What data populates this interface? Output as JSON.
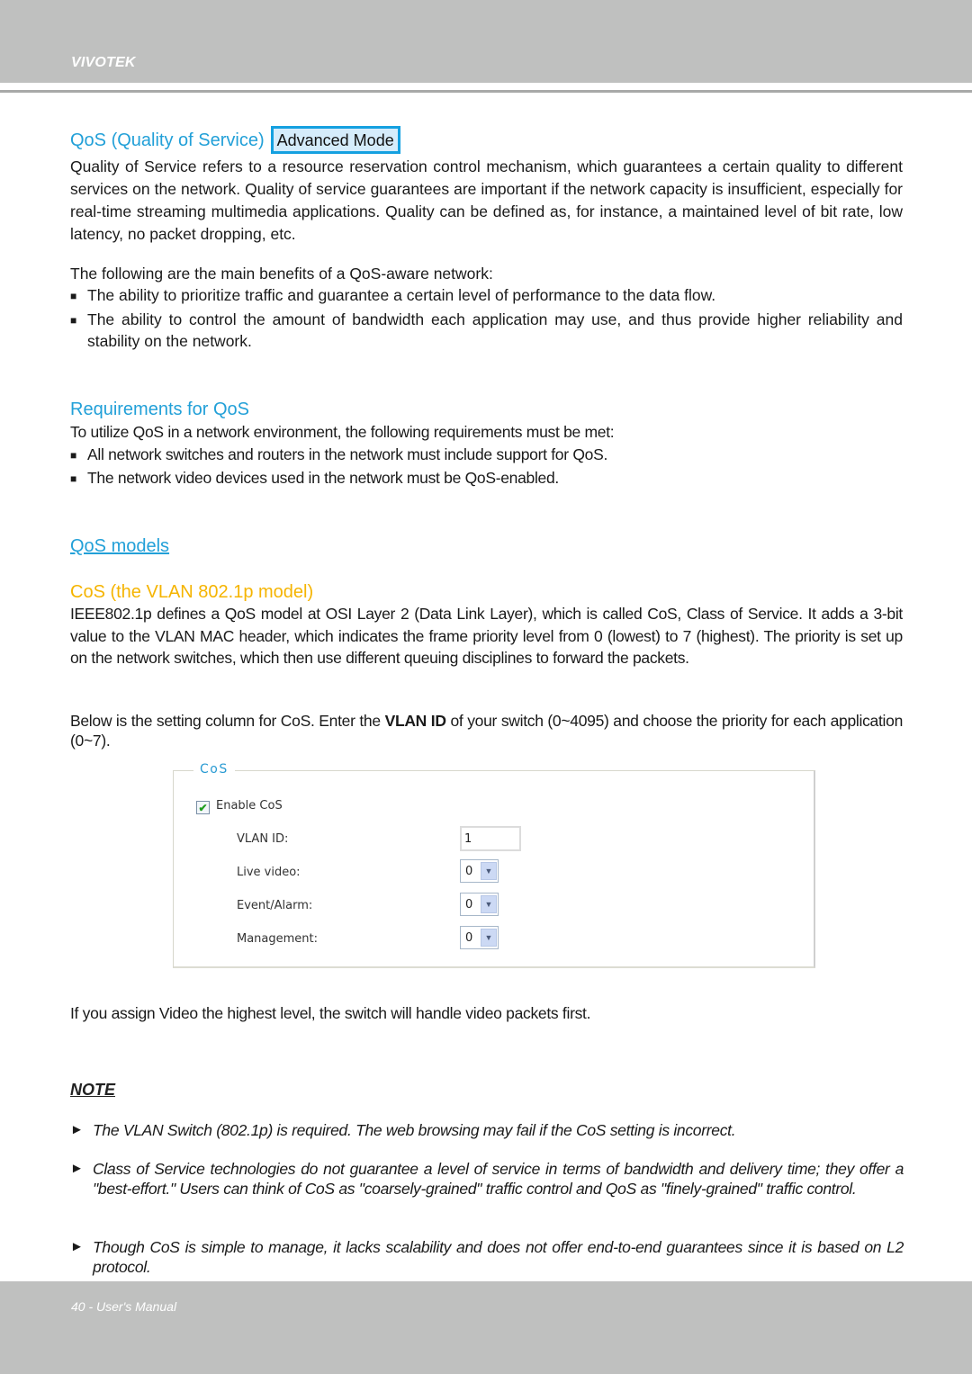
{
  "header": {
    "brand": "VIVOTEK"
  },
  "section_qos": {
    "title": "QoS (Quality of Service)",
    "badge": "Advanced Mode",
    "intro": "Quality of Service refers to a resource reservation control mechanism, which guarantees a certain quality to different services on the network. Quality of service guarantees are important if the network capacity is insufficient, especially for real-time streaming multimedia applications. Quality can be defined as, for instance, a maintained level of bit rate, low latency, no packet dropping, etc.",
    "benefits_lead": "The following are the main benefits of a QoS-aware network:",
    "benefits": [
      "The ability to prioritize traffic and guarantee a certain level of performance to the data flow.",
      "The ability to control the amount of bandwidth each application may use, and thus provide higher reliability and stability on the network."
    ],
    "bullet_symbol": "■"
  },
  "section_requirements": {
    "title": "Requirements for QoS",
    "lead": "To utilize QoS in a network environment, the following requirements must be met:",
    "items": [
      "All network switches and routers in the network must include support for QoS.",
      "The network video devices used in the network must be QoS-enabled."
    ]
  },
  "section_models": {
    "link": "QoS models",
    "cos_title": "CoS (the VLAN 802.1p model)",
    "cos_desc": "IEEE802.1p defines a QoS model at OSI Layer 2 (Data Link Layer), which is called CoS, Class of Service. It adds a 3-bit value to the VLAN MAC header, which indicates the frame priority level from 0 (lowest) to 7 (highest). The priority is set up on the network switches, which then use different queuing disciplines to forward the packets.",
    "setting_lead_1": "Below is the setting column for CoS. Enter the ",
    "setting_lead_bold": "VLAN ID",
    "setting_lead_2": " of your switch (0~4095) and choose the priority for each application (0~7)."
  },
  "cos_panel": {
    "legend": "CoS",
    "enable_label": "Enable CoS",
    "enable_checked": true,
    "vlan_id_label": "VLAN ID:",
    "vlan_id_value": "1",
    "live_video_label": "Live video:",
    "live_video_value": "0",
    "event_alarm_label": "Event/Alarm:",
    "event_alarm_value": "0",
    "management_label": "Management:",
    "management_value": "0"
  },
  "after_panel": "If you assign Video the highest level, the switch will handle video packets first.",
  "note": {
    "title": "NOTE",
    "marker": "►",
    "items": [
      "The VLAN Switch (802.1p) is required.  The web browsing may fail if the CoS setting is incorrect.",
      "Class of Service technologies do not guarantee a level of service in terms of bandwidth and delivery time; they offer a \"best-effort.\" Users can think of CoS as \"coarsely-grained\" traffic control and QoS as \"finely-grained\" traffic control.",
      "Though CoS is simple to manage, it lacks scalability and does not offer end-to-end guarantees since it is based on L2 protocol."
    ]
  },
  "footer": {
    "page_label": "40 - User's Manual"
  },
  "colors": {
    "heading_blue": "#22a0d8",
    "heading_orange": "#f5b400",
    "band_gray": "#bfc0bf",
    "badge_border": "#14a0e0"
  }
}
